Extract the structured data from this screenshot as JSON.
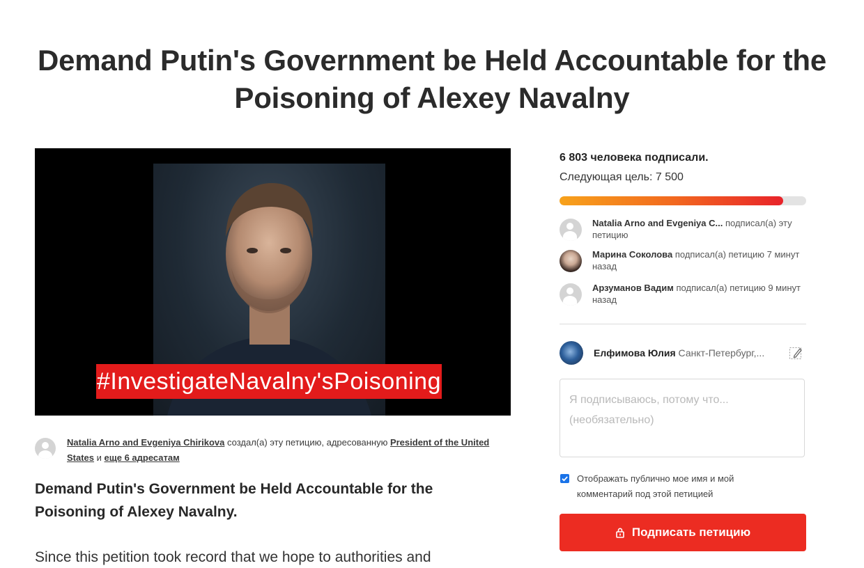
{
  "page": {
    "title": "Demand Putin's Government be Held Accountable for the Poisoning of Alexey Navalny"
  },
  "hero": {
    "hashtag": "#InvestigateNavalny'sPoisoning"
  },
  "creator": {
    "names": "Natalia Arno and Evgeniya Chirikova",
    "created_text": " создал(а) эту петицию, адресованную ",
    "recipient": "President of the United States",
    "and_text": " и ",
    "more_recipients": "еще 6 адресатам"
  },
  "petition": {
    "heading": "Demand Putin's Government be Held Accountable for the Poisoning of Alexey Navalny.",
    "body_start": "Since this petition took record that we hope to authorities and"
  },
  "sidebar": {
    "signature_count": "6 803 человека подписали.",
    "next_goal": "Следующая цель: 7 500",
    "progress_fraction": 0.907,
    "recent_signers": [
      {
        "name": "Natalia Arno and Evgeniya C...",
        "action": " подписал(а) эту петицию",
        "avatar": "generic-user-icon"
      },
      {
        "name": "Марина Соколова",
        "action": " подписал(а) петицию 7 минут назад",
        "avatar": "user-photo"
      },
      {
        "name": "Арзуманов Вадим",
        "action": " подписал(а) петицию 9 минут назад",
        "avatar": "generic-user-icon"
      }
    ],
    "current_user": {
      "name": "Елфимова Юлия",
      "location": " Санкт-Петербург,..."
    },
    "reason_placeholder": "Я подписываюсь, потому что... (необязательно)",
    "display_publicly_label": "Отображать публично мое имя и мой комментарий под этой петицией",
    "display_publicly_checked": true,
    "sign_button_label": "Подписать петицию"
  },
  "colors": {
    "accent_red": "#ec2c22",
    "progress_start": "#f7a21b",
    "progress_end": "#e8232a",
    "checkbox_blue": "#1a73e8"
  }
}
